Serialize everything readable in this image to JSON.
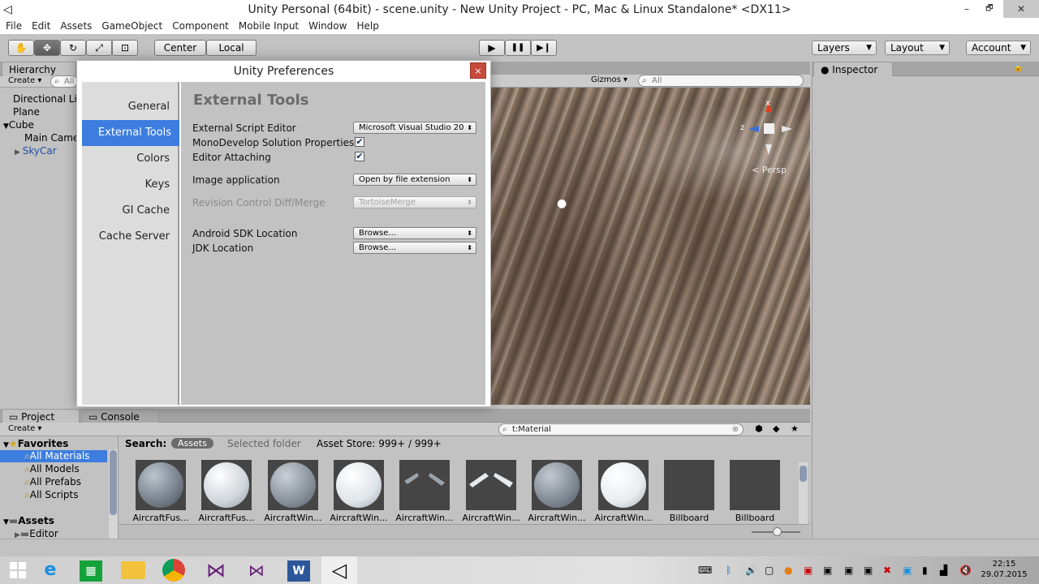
{
  "window": {
    "title": "Unity Personal (64bit) - scene.unity - New Unity Project - PC, Mac & Linux Standalone* <DX11>",
    "minimize": "–",
    "restore": "🗗",
    "close": "✕"
  },
  "menu": [
    "File",
    "Edit",
    "Assets",
    "GameObject",
    "Component",
    "Mobile Input",
    "Window",
    "Help"
  ],
  "toolbar": {
    "tools": [
      "✋",
      "✥",
      "↻",
      "⤢",
      "⊡"
    ],
    "center": "Center",
    "local": "Local",
    "play": "▶",
    "pause": "❚❚",
    "step": "▶❙",
    "layers": "Layers",
    "layout": "Layout",
    "account": "Account"
  },
  "hierarchy": {
    "tab": "Hierarchy",
    "create": "Create",
    "search": "All",
    "items": [
      {
        "label": "Directional Lig"
      },
      {
        "label": "Plane"
      },
      {
        "label": "Cube"
      },
      {
        "label": "Main Came"
      },
      {
        "label": "SkyCar"
      }
    ]
  },
  "scene": {
    "gizmos": "Gizmos",
    "search": "All",
    "persp": "Persp",
    "axis_x": "x",
    "axis_z": "z"
  },
  "inspector": {
    "tab": "Inspector"
  },
  "preferences": {
    "title": "Unity Preferences",
    "close": "×",
    "nav": [
      "General",
      "External Tools",
      "Colors",
      "Keys",
      "GI Cache",
      "Cache Server"
    ],
    "selected": "External Tools",
    "heading": "External Tools",
    "rows": [
      {
        "label": "External Script Editor",
        "value": "Microsoft Visual Studio 20"
      },
      {
        "label": "MonoDevelop Solution Properties",
        "check": "✔"
      },
      {
        "label": "Editor Attaching",
        "check": "✔"
      },
      {
        "label": "Image application",
        "value": "Open by file extension"
      },
      {
        "label": "Revision Control Diff/Merge",
        "value": "TortoiseMerge"
      },
      {
        "label": "Android SDK Location",
        "value": "Browse..."
      },
      {
        "label": "JDK Location",
        "value": "Browse..."
      }
    ]
  },
  "project": {
    "tab": "Project",
    "console": "Console",
    "create": "Create",
    "search_value": "t:Material",
    "favorites": "Favorites",
    "fav_items": [
      "All Materials",
      "All Models",
      "All Prefabs",
      "All Scripts"
    ],
    "assets": "Assets",
    "asset_items": [
      "Editor"
    ],
    "search_label": "Search:",
    "scope_assets": "Assets",
    "scope_folder": "Selected folder",
    "store": "Asset Store: 999+ / 999+",
    "thumbnails": [
      "AircraftFus...",
      "AircraftFus...",
      "AircraftWin...",
      "AircraftWin...",
      "AircraftWin...",
      "AircraftWin...",
      "AircraftWin...",
      "AircraftWin...",
      "Billboard",
      "Billboard"
    ]
  },
  "taskbar": {
    "time": "22:15",
    "date": "29.07.2015",
    "apps": [
      "windows-icon",
      "internet-explorer-icon",
      "store-icon",
      "file-explorer-icon",
      "chrome-icon",
      "visual-studio-icon",
      "visual-studio-preview-icon",
      "word-icon",
      "unity-icon"
    ]
  }
}
